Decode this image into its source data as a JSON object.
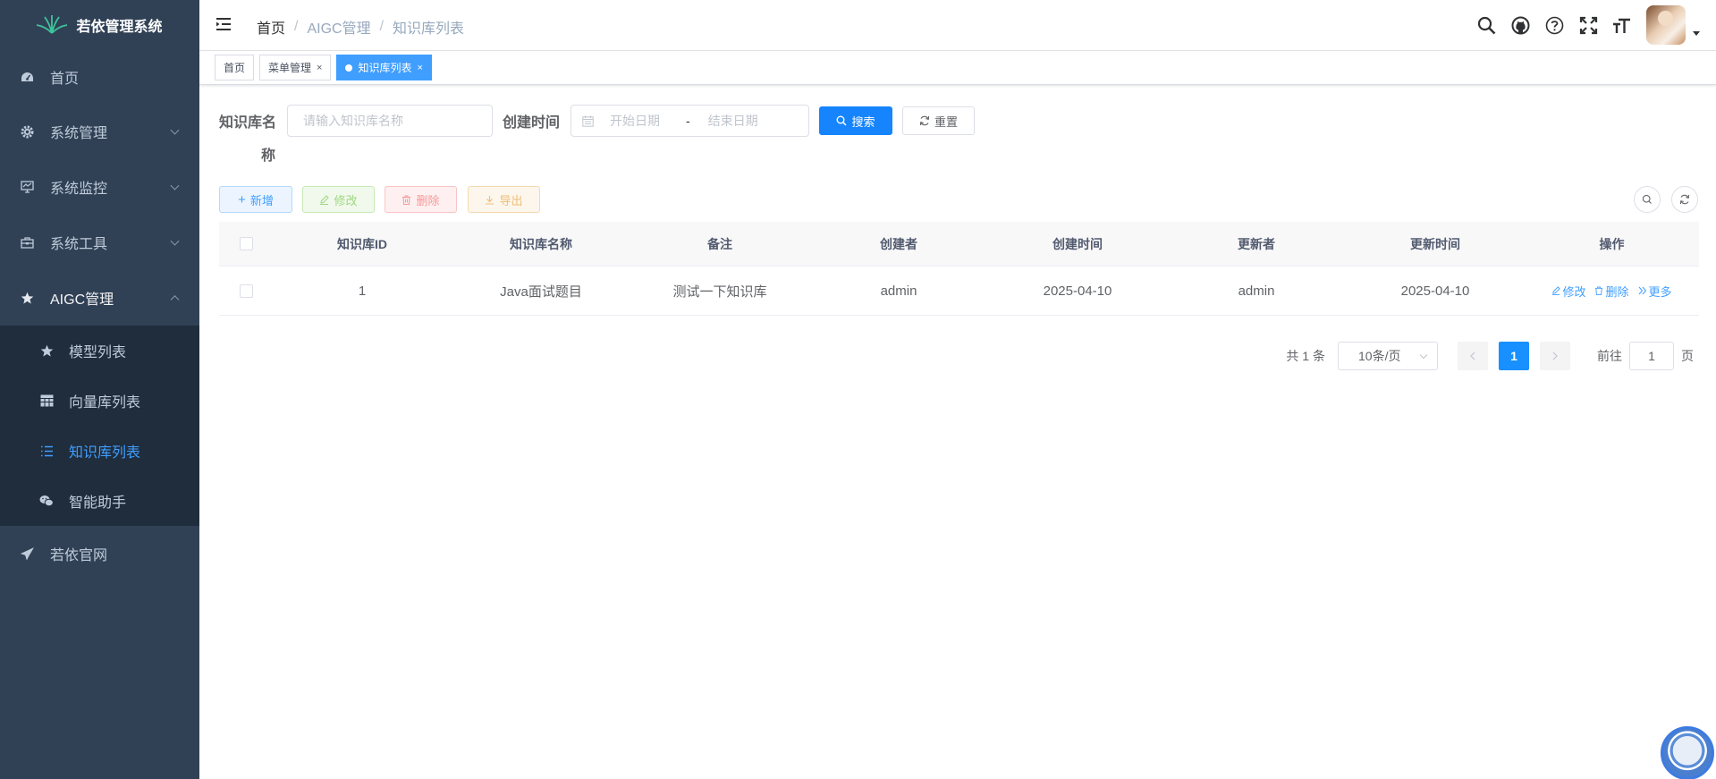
{
  "app": {
    "title": "若依管理系统"
  },
  "sidebar": {
    "items": [
      {
        "label": "首页",
        "icon": "dashboard-icon"
      },
      {
        "label": "系统管理",
        "icon": "gear-icon",
        "expandable": true
      },
      {
        "label": "系统监控",
        "icon": "monitor-icon",
        "expandable": true
      },
      {
        "label": "系统工具",
        "icon": "toolbox-icon",
        "expandable": true
      },
      {
        "label": "AIGC管理",
        "icon": "star-icon",
        "expanded": true
      }
    ],
    "subitems": [
      {
        "label": "模型列表",
        "icon": "star-icon"
      },
      {
        "label": "向量库列表",
        "icon": "table-icon"
      },
      {
        "label": "知识库列表",
        "icon": "list-icon",
        "active": true
      },
      {
        "label": "智能助手",
        "icon": "wechat-icon"
      }
    ],
    "bottom": {
      "label": "若依官网",
      "icon": "send-icon"
    }
  },
  "navbar": {
    "breadcrumb": [
      "首页",
      "AIGC管理",
      "知识库列表"
    ],
    "separator": "/"
  },
  "tags": [
    {
      "label": "首页"
    },
    {
      "label": "菜单管理",
      "close": "×"
    },
    {
      "label": "知识库列表",
      "close": "×",
      "active": true
    }
  ],
  "search": {
    "name_label_line1": "知识库名",
    "name_label_line2": "称",
    "name_placeholder": "请输入知识库名称",
    "time_label": "创建时间",
    "start_placeholder": "开始日期",
    "range_sep": "-",
    "end_placeholder": "结束日期",
    "search_button": "搜索",
    "reset_button": "重置"
  },
  "toolbar": {
    "add": "新增",
    "edit": "修改",
    "delete": "删除",
    "export": "导出"
  },
  "table": {
    "columns": [
      "知识库ID",
      "知识库名称",
      "备注",
      "创建者",
      "创建时间",
      "更新者",
      "更新时间",
      "操作"
    ],
    "rows": [
      {
        "id": "1",
        "name": "Java面试题目",
        "remark": "测试一下知识库",
        "creator": "admin",
        "create_time": "2025-04-10",
        "updater": "admin",
        "update_time": "2025-04-10"
      }
    ],
    "actions": {
      "edit": "修改",
      "delete": "删除",
      "more": "更多"
    }
  },
  "pagination": {
    "total": "共 1 条",
    "page_size": "10条/页",
    "current_page": "1",
    "goto_label": "前往",
    "goto_value": "1",
    "page_suffix": "页"
  },
  "colors": {
    "sidebar_bg": "#304156",
    "submenu_bg": "#1f2d3d",
    "accent": "#409eff",
    "primary_button": "#1684fc"
  }
}
